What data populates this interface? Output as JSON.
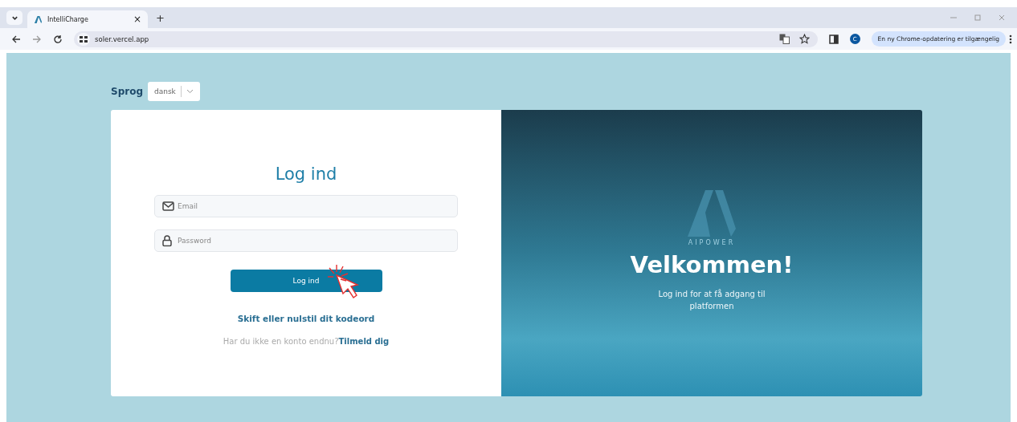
{
  "browser": {
    "tab": {
      "title": "IntelliCharge",
      "close": "×"
    },
    "new_tab": "+",
    "address": "soler.vercel.app",
    "profile": "C",
    "update_notice": "En ny Chrome-opdatering er tilgængelig"
  },
  "language": {
    "label": "Sprog",
    "value": "dansk"
  },
  "login": {
    "title": "Log ind",
    "email": {
      "placeholder": "Email"
    },
    "password": {
      "placeholder": "Password"
    },
    "button": "Log ind",
    "reset_link": "Skift eller nulstil dit kodeord",
    "signup_prompt": "Har du ikke en konto endnu?",
    "signup_link": "Tilmeld dig"
  },
  "welcome": {
    "logo_text": "AIPOWER",
    "title": "Velkommen!",
    "subtitle": "Log ind for at få adgang til platformen"
  }
}
